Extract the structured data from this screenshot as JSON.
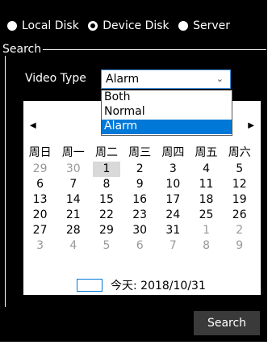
{
  "source": {
    "options": [
      {
        "label": "Local Disk",
        "selected": false
      },
      {
        "label": "Device Disk",
        "selected": true
      },
      {
        "label": "Server",
        "selected": false
      }
    ]
  },
  "search_group": {
    "title": "Search",
    "video_type_label": "Video Type",
    "video_type_value": "Alarm",
    "dropdown_options": [
      "Both",
      "Normal",
      "Alarm"
    ]
  },
  "calendar": {
    "weekdays": [
      "周日",
      "周一",
      "周二",
      "周三",
      "周四",
      "周五",
      "周六"
    ],
    "weeks": [
      [
        {
          "d": "29",
          "o": true
        },
        {
          "d": "30",
          "o": true
        },
        {
          "d": "1",
          "t": true
        },
        {
          "d": "2"
        },
        {
          "d": "3"
        },
        {
          "d": "4"
        },
        {
          "d": "5"
        }
      ],
      [
        {
          "d": "6"
        },
        {
          "d": "7"
        },
        {
          "d": "8"
        },
        {
          "d": "9"
        },
        {
          "d": "10"
        },
        {
          "d": "11"
        },
        {
          "d": "12"
        }
      ],
      [
        {
          "d": "13"
        },
        {
          "d": "14"
        },
        {
          "d": "15"
        },
        {
          "d": "16"
        },
        {
          "d": "17"
        },
        {
          "d": "18"
        },
        {
          "d": "19"
        }
      ],
      [
        {
          "d": "20"
        },
        {
          "d": "21"
        },
        {
          "d": "22"
        },
        {
          "d": "23"
        },
        {
          "d": "24"
        },
        {
          "d": "25"
        },
        {
          "d": "26"
        }
      ],
      [
        {
          "d": "27"
        },
        {
          "d": "28"
        },
        {
          "d": "29"
        },
        {
          "d": "30"
        },
        {
          "d": "31"
        },
        {
          "d": "1",
          "o": true
        },
        {
          "d": "2",
          "o": true
        }
      ],
      [
        {
          "d": "3",
          "o": true
        },
        {
          "d": "4",
          "o": true
        },
        {
          "d": "5",
          "o": true
        },
        {
          "d": "6",
          "o": true
        },
        {
          "d": "7",
          "o": true
        },
        {
          "d": "8",
          "o": true
        },
        {
          "d": "9",
          "o": true
        }
      ]
    ],
    "today_text": "今天: 2018/10/31"
  },
  "search_button": "Search"
}
